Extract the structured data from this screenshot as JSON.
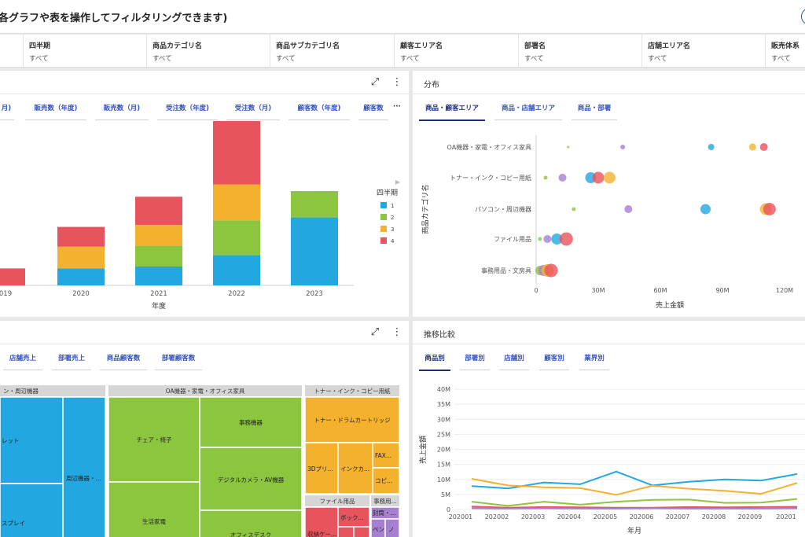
{
  "header": {
    "title": "各グラフや表を操作してフィルタリングできます)"
  },
  "filters": [
    {
      "label": "四半期",
      "value": "すべて"
    },
    {
      "label": "商品カテゴリ名",
      "value": "すべて"
    },
    {
      "label": "商品サブカテゴリ名",
      "value": "すべて"
    },
    {
      "label": "顧客エリア名",
      "value": "すべて"
    },
    {
      "label": "部署名",
      "value": "すべて"
    },
    {
      "label": "店舗エリア名",
      "value": "すべて"
    },
    {
      "label": "販売体系",
      "value": "すべて"
    }
  ],
  "panel1": {
    "tabs": [
      "月)",
      "販売数（年度)",
      "販売数（月)",
      "受注数（年度)",
      "受注数（月)",
      "顧客数（年度)",
      "顧客数"
    ],
    "more": "···",
    "chart_data": {
      "type": "bar",
      "xlabel": "年度",
      "categories": [
        "019",
        "2020",
        "2021",
        "2022",
        "2023"
      ],
      "legend_title": "四半期",
      "series": [
        {
          "name": "1",
          "color": "#22a7e0",
          "values": [
            0,
            18,
            20,
            32,
            72
          ]
        },
        {
          "name": "2",
          "color": "#8cc63e",
          "values": [
            0,
            0,
            22,
            37,
            28
          ]
        },
        {
          "name": "3",
          "color": "#f4b12e",
          "values": [
            0,
            23,
            22,
            38,
            0
          ]
        },
        {
          "name": "4",
          "color": "#e8545d",
          "values": [
            18,
            21,
            30,
            70,
            0
          ]
        }
      ]
    }
  },
  "panel2": {
    "title": "分布",
    "tabs": [
      "商品・顧客エリア",
      "商品・店舗エリア",
      "商品・部署"
    ],
    "chart_data": {
      "type": "scatter",
      "xlabel": "売上金額",
      "ylabel": "商品カテゴリ名",
      "categories": [
        "OA機器・家電・オフィス家具",
        "トナー・インク・コピー用紙",
        "パソコン・周辺機器",
        "ファイル用品",
        "事務用品・文房具"
      ],
      "xticks": [
        "0",
        "30M",
        "60M",
        "90M",
        "120M"
      ],
      "xlim": [
        0,
        132000000
      ],
      "points": [
        {
          "cat": 0,
          "x": 17000000,
          "r": 1.5,
          "color": "#8cc63e"
        },
        {
          "cat": 0,
          "x": 46000000,
          "r": 3,
          "color": "#a77fd0"
        },
        {
          "cat": 0,
          "x": 93000000,
          "r": 4,
          "color": "#22a7e0"
        },
        {
          "cat": 0,
          "x": 115000000,
          "r": 4.5,
          "color": "#f4b12e"
        },
        {
          "cat": 0,
          "x": 121000000,
          "r": 5,
          "color": "#e8545d"
        },
        {
          "cat": 1,
          "x": 5000000,
          "r": 2.5,
          "color": "#8cc63e"
        },
        {
          "cat": 1,
          "x": 14000000,
          "r": 5,
          "color": "#a77fd0"
        },
        {
          "cat": 1,
          "x": 29000000,
          "r": 7,
          "color": "#22a7e0"
        },
        {
          "cat": 1,
          "x": 33000000,
          "r": 7.5,
          "color": "#e8545d"
        },
        {
          "cat": 1,
          "x": 39000000,
          "r": 7.5,
          "color": "#f4b12e"
        },
        {
          "cat": 2,
          "x": 20000000,
          "r": 2.5,
          "color": "#8cc63e"
        },
        {
          "cat": 2,
          "x": 49000000,
          "r": 5,
          "color": "#a77fd0"
        },
        {
          "cat": 2,
          "x": 90000000,
          "r": 6.5,
          "color": "#22a7e0"
        },
        {
          "cat": 2,
          "x": 122000000,
          "r": 7.5,
          "color": "#f4b12e"
        },
        {
          "cat": 2,
          "x": 124000000,
          "r": 8,
          "color": "#e8545d"
        },
        {
          "cat": 3,
          "x": 2000000,
          "r": 2.5,
          "color": "#8cc63e"
        },
        {
          "cat": 3,
          "x": 6000000,
          "r": 5,
          "color": "#a77fd0"
        },
        {
          "cat": 3,
          "x": 11000000,
          "r": 7,
          "color": "#22a7e0"
        },
        {
          "cat": 3,
          "x": 16000000,
          "r": 8.5,
          "color": "#e8545d"
        },
        {
          "cat": 4,
          "x": 2000000,
          "r": 6,
          "color": "#8cc63e"
        },
        {
          "cat": 4,
          "x": 4000000,
          "r": 7,
          "color": "#a77fd0"
        },
        {
          "cat": 4,
          "x": 6000000,
          "r": 8,
          "color": "#f4b12e"
        },
        {
          "cat": 4,
          "x": 8000000,
          "r": 8.5,
          "color": "#e8545d"
        }
      ]
    }
  },
  "panel3": {
    "tabs": [
      "店舗売上",
      "部署売上",
      "商品顧客数",
      "部署顧客数"
    ],
    "treemap": {
      "groups": [
        {
          "name": "ン・周辺機器",
          "color": "#22a7e0",
          "items": [
            "レット",
            "周辺機器・...",
            "スプレイ"
          ]
        },
        {
          "name": "OA機器・家電・オフィス家具",
          "color": "#8cc63e",
          "items": [
            "チェア・椅子",
            "事務機器",
            "デジタルカメラ・AV機器",
            "生活家電",
            "オフィスデスク"
          ]
        },
        {
          "name": "トナー・インク・コピー用紙",
          "color": "#f4b12e",
          "items": [
            "トナー・ドラムカートリッジ",
            "3Dプリ...",
            "インクカ...",
            "FAX...",
            "コピ..."
          ]
        },
        {
          "name": "ファイル用品",
          "color": "#e8545d",
          "items": [
            "ボック...",
            "収納ケー..."
          ]
        },
        {
          "name": "事務用...",
          "color": "#a77fd0",
          "items": [
            "封筒・...",
            "ペン",
            "ノ"
          ]
        }
      ]
    }
  },
  "panel4": {
    "title": "推移比較",
    "tabs": [
      "商品別",
      "部署別",
      "店舗別",
      "顧客別",
      "業界別"
    ],
    "chart_data": {
      "type": "line",
      "xlabel": "年月",
      "ylabel": "売上金額",
      "x": [
        "202001",
        "202002",
        "202003",
        "202004",
        "202005",
        "202006",
        "202007",
        "202008",
        "202009",
        "20201"
      ],
      "yticks": [
        "0",
        "5M",
        "10M",
        "15M",
        "20M",
        "25M",
        "30M",
        "35M",
        "40M"
      ],
      "ylim": [
        0,
        40000000
      ],
      "series": [
        {
          "color": "#22a7e0",
          "values": [
            7800000,
            7000000,
            9000000,
            8400000,
            12600000,
            8000000,
            9200000,
            10000000,
            9600000,
            11800000
          ]
        },
        {
          "color": "#f4b12e",
          "values": [
            10200000,
            8000000,
            7400000,
            7100000,
            4900000,
            7900000,
            6900000,
            6200000,
            5200000,
            8800000
          ]
        },
        {
          "color": "#8cc63e",
          "values": [
            2600000,
            1200000,
            2600000,
            1600000,
            2600000,
            3200000,
            3300000,
            2200000,
            2300000,
            3500000
          ]
        },
        {
          "color": "#e8545d",
          "values": [
            1000000,
            600000,
            800000,
            700000,
            600000,
            600000,
            800000,
            700000,
            800000,
            900000
          ]
        },
        {
          "color": "#a77fd0",
          "values": [
            400000,
            300000,
            400000,
            300000,
            300000,
            400000,
            300000,
            300000,
            300000,
            400000
          ]
        }
      ]
    }
  }
}
